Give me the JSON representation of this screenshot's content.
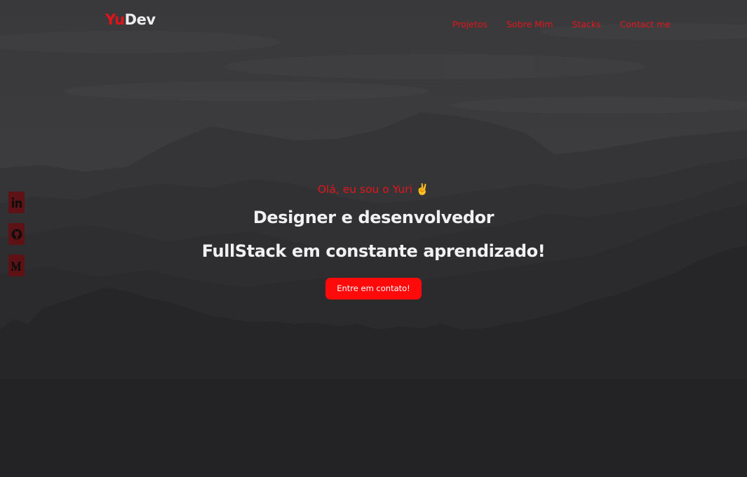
{
  "header": {
    "brand_part1": "Yu",
    "brand_part2": "Dev",
    "nav": [
      {
        "label": "Projetos"
      },
      {
        "label": "Sobre Mim"
      },
      {
        "label": "Stacks"
      },
      {
        "label": "Contact me"
      }
    ]
  },
  "social": [
    {
      "icon": "linkedin-icon",
      "glyph": "in"
    },
    {
      "icon": "github-icon",
      "glyph": "github"
    },
    {
      "icon": "medium-icon",
      "glyph": "M"
    }
  ],
  "hero": {
    "greeting": "Olá, eu sou o Yuri ✌️",
    "line1": "Designer e desenvolvedor",
    "line2": "FullStack em constante aprendizado!",
    "cta": "Entre em contato!"
  },
  "colors": {
    "accent": "#e3161c",
    "button": "#ff0a0a",
    "background": "#252527",
    "text": "#f1f1f1"
  }
}
